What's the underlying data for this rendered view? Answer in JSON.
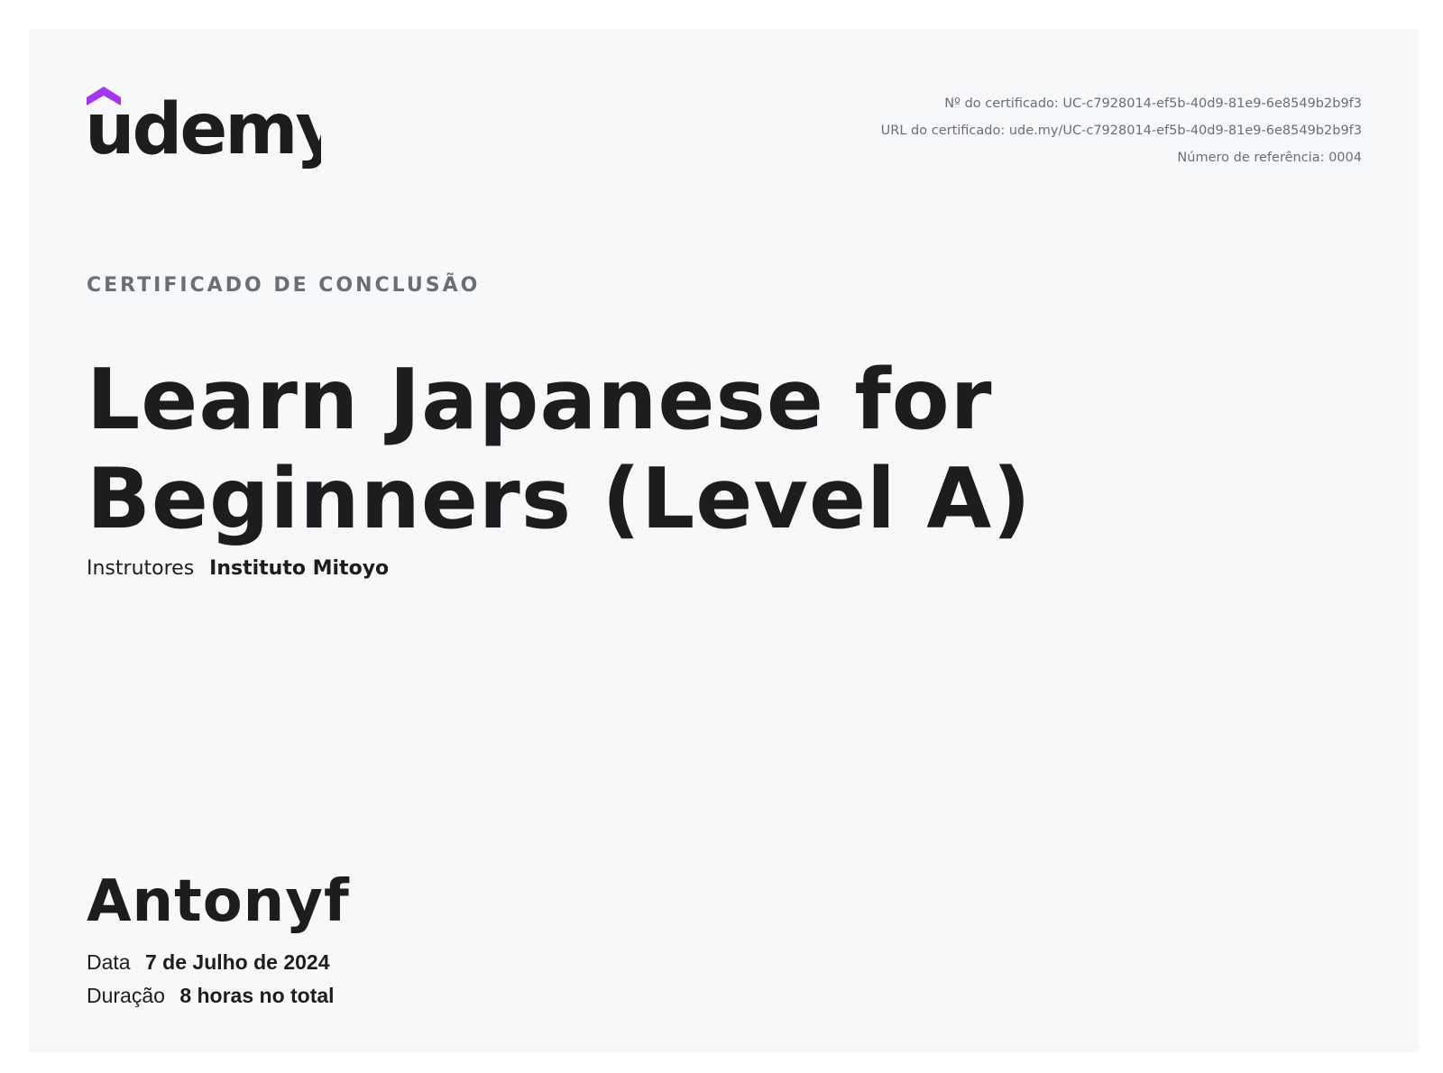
{
  "brand": {
    "logo_text": "udemy",
    "accent_color": "#a435f0",
    "text_color": "#1c1d1f"
  },
  "certificate_meta": {
    "certificate_number": "Nº do certificado: UC-c7928014-ef5b-40d9-81e9-6e8549b2b9f3",
    "certificate_url": "URL do certificado: ude.my/UC-c7928014-ef5b-40d9-81e9-6e8549b2b9f3",
    "reference_number": "Número de referência: 0004"
  },
  "heading": {
    "eyebrow": "CERTIFICADO DE CONCLUSÃO",
    "course_title": "Learn Japanese for Beginners (Level A)"
  },
  "instructors": {
    "label": "Instrutores",
    "value": "Instituto Mitoyo"
  },
  "student": {
    "name": "Antonyf"
  },
  "details": {
    "date_label": "Data",
    "date_value": "7 de Julho de 2024",
    "duration_label": "Duração",
    "duration_value": "8 horas no total"
  },
  "colors": {
    "page_background": "#ffffff",
    "card_background": "#f7f8fa",
    "muted_text": "#6a6f73"
  }
}
